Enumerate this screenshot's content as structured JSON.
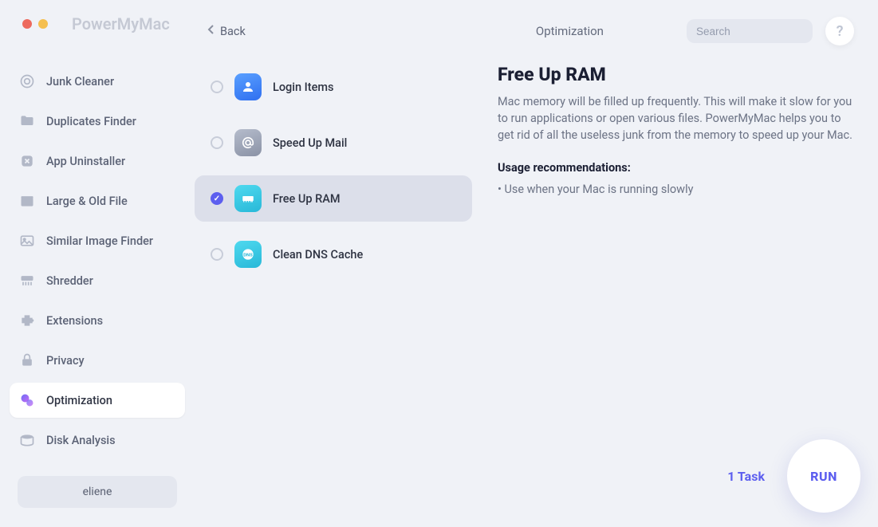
{
  "app_title": "PowerMyMac",
  "back_label": "Back",
  "header": {
    "section_label": "Optimization",
    "search_placeholder": "Search",
    "help_symbol": "?"
  },
  "sidebar": {
    "items": [
      {
        "label": "Junk Cleaner",
        "icon": "target-icon"
      },
      {
        "label": "Duplicates Finder",
        "icon": "folder-icon"
      },
      {
        "label": "App Uninstaller",
        "icon": "app-icon"
      },
      {
        "label": "Large & Old File",
        "icon": "box-icon"
      },
      {
        "label": "Similar Image Finder",
        "icon": "image-icon"
      },
      {
        "label": "Shredder",
        "icon": "shredder-icon"
      },
      {
        "label": "Extensions",
        "icon": "puzzle-icon"
      },
      {
        "label": "Privacy",
        "icon": "lock-icon"
      },
      {
        "label": "Optimization",
        "icon": "sparkle-icon"
      },
      {
        "label": "Disk Analysis",
        "icon": "disk-icon"
      }
    ],
    "active_index": 8
  },
  "user": {
    "name": "eliene"
  },
  "tasks": [
    {
      "label": "Login Items",
      "checked": false,
      "icon_bg": "#4a8cf6",
      "icon_symbol": "user"
    },
    {
      "label": "Speed Up Mail",
      "checked": false,
      "icon_bg": "#9fa6b8",
      "icon_symbol": "at"
    },
    {
      "label": "Free Up RAM",
      "checked": true,
      "icon_bg": "#3dc9e6",
      "icon_symbol": "ram"
    },
    {
      "label": "Clean DNS Cache",
      "checked": false,
      "icon_bg": "#3dc9e6",
      "icon_symbol": "dns"
    }
  ],
  "detail": {
    "title": "Free Up RAM",
    "description": "Mac memory will be filled up frequently. This will make it slow for you to run applications or open various files. PowerMyMac helps you to get rid of all the useless junk from the memory to speed up your Mac.",
    "recommend_heading": "Usage recommendations:",
    "recommend_item": "• Use when your Mac is running slowly"
  },
  "footer": {
    "task_count_label": "1 Task",
    "run_label": "RUN"
  }
}
